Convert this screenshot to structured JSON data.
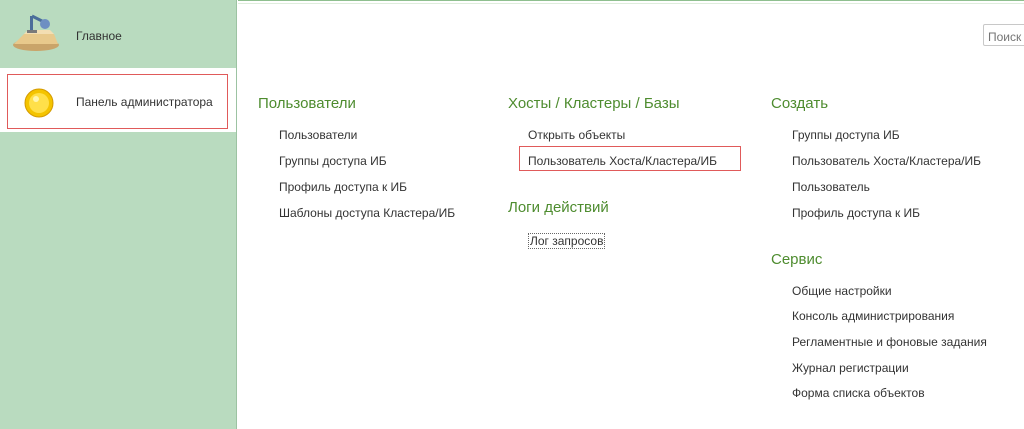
{
  "sidebar": {
    "items": [
      {
        "label": "Главное",
        "icon": "desk-lamp-icon"
      },
      {
        "label": "Панель администратора",
        "icon": "gold-circle-icon"
      }
    ]
  },
  "search": {
    "placeholder": "Поиск"
  },
  "groups": {
    "users": {
      "title": "Пользователи",
      "links": [
        "Пользователи",
        "Группы доступа ИБ",
        "Профиль доступа к ИБ",
        "Шаблоны доступа Кластера/ИБ"
      ]
    },
    "hosts": {
      "title": "Хосты / Кластеры / Базы",
      "links": [
        "Открыть объекты",
        "Пользователь Хоста/Кластера/ИБ"
      ]
    },
    "logs": {
      "title": "Логи действий",
      "links": [
        "Лог запросов"
      ]
    },
    "create": {
      "title": "Создать",
      "links": [
        "Группы доступа ИБ",
        "Пользователь Хоста/Кластера/ИБ",
        "Пользователь",
        "Профиль доступа к ИБ"
      ]
    },
    "service": {
      "title": "Сервис",
      "links": [
        "Общие настройки",
        "Консоль администрирования",
        "Регламентные и фоновые задания",
        "Журнал регистрации",
        "Форма списка объектов"
      ]
    }
  },
  "colors": {
    "sidebar": "#b9dbbf",
    "group_title": "#4e8c2f",
    "highlight": "#e05a5a"
  }
}
